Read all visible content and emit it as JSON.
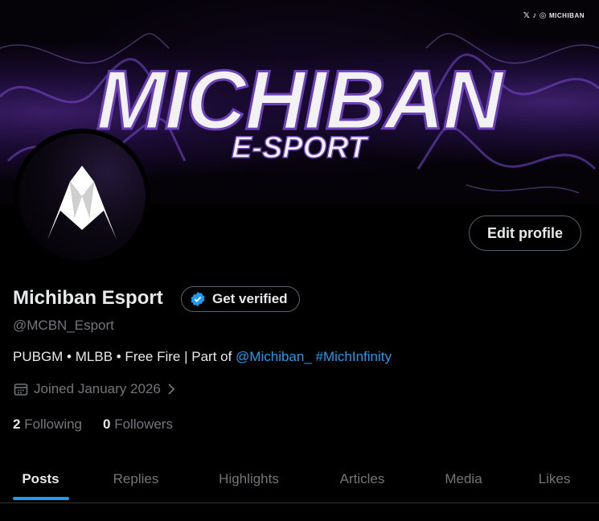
{
  "banner": {
    "logo_main": "MICHIBAN",
    "logo_sub": "E-SPORT",
    "social_label": "MICHIBAN"
  },
  "profile": {
    "name": "Michiban Esport",
    "verify_label": "Get verified",
    "handle": "@MCBN_Esport",
    "bio_text": "PUBGM • MLBB • Free Fire | Part of ",
    "bio_mention": "@Michiban_",
    "bio_hashtag": "#MichInfinity",
    "joined": "Joined January 2026",
    "following_count": "2",
    "following_label": "Following",
    "followers_count": "0",
    "followers_label": "Followers"
  },
  "actions": {
    "edit_profile": "Edit profile"
  },
  "tabs": [
    {
      "label": "Posts",
      "active": true
    },
    {
      "label": "Replies"
    },
    {
      "label": "Highlights"
    },
    {
      "label": "Articles"
    },
    {
      "label": "Media"
    },
    {
      "label": "Likes"
    }
  ],
  "colors": {
    "accent": "#1d9bf0",
    "muted": "#71767b",
    "text": "#e7e9ea",
    "border": "#536471"
  }
}
